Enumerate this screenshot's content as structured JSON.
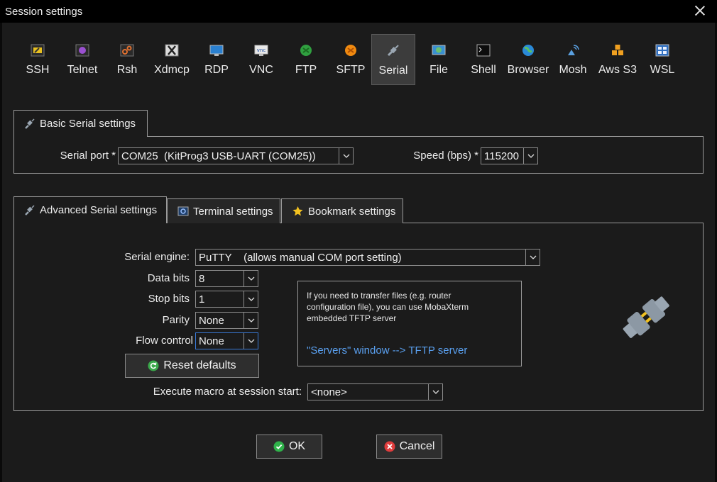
{
  "window": {
    "title": "Session settings"
  },
  "toolbar": {
    "items": [
      {
        "label": "SSH",
        "icon": "ssh-icon"
      },
      {
        "label": "Telnet",
        "icon": "telnet-icon"
      },
      {
        "label": "Rsh",
        "icon": "rsh-icon"
      },
      {
        "label": "Xdmcp",
        "icon": "xdmcp-icon"
      },
      {
        "label": "RDP",
        "icon": "rdp-icon"
      },
      {
        "label": "VNC",
        "icon": "vnc-icon"
      },
      {
        "label": "FTP",
        "icon": "ftp-icon"
      },
      {
        "label": "SFTP",
        "icon": "sftp-icon"
      },
      {
        "label": "Serial",
        "icon": "serial-plug-icon",
        "selected": true
      },
      {
        "label": "File",
        "icon": "file-icon"
      },
      {
        "label": "Shell",
        "icon": "shell-icon"
      },
      {
        "label": "Browser",
        "icon": "browser-icon"
      },
      {
        "label": "Mosh",
        "icon": "mosh-icon"
      },
      {
        "label": "Aws S3",
        "icon": "aws-s3-icon"
      },
      {
        "label": "WSL",
        "icon": "wsl-icon"
      }
    ]
  },
  "basic": {
    "tab_label": "Basic Serial settings",
    "serial_port_label": "Serial port *",
    "serial_port_value": "COM25  (KitProg3 USB-UART (COM25))",
    "speed_label": "Speed (bps) *",
    "speed_value": "115200"
  },
  "advanced": {
    "tabs": [
      {
        "label": "Advanced Serial settings",
        "icon": "serial-plug-icon",
        "active": true
      },
      {
        "label": "Terminal settings",
        "icon": "terminal-settings-icon"
      },
      {
        "label": "Bookmark settings",
        "icon": "star-icon"
      }
    ],
    "engine_label": "Serial engine:",
    "engine_value": "PuTTY    (allows manual COM port setting)",
    "data_bits_label": "Data bits",
    "data_bits_value": "8",
    "stop_bits_label": "Stop bits",
    "stop_bits_value": "1",
    "parity_label": "Parity",
    "parity_value": "None",
    "flow_control_label": "Flow control",
    "flow_control_value": "None",
    "reset_label": "Reset defaults",
    "macro_label": "Execute macro at session start:",
    "macro_value": "<none>",
    "info_text": "If you need to transfer files (e.g. router configuration file), you can use MobaXterm embedded TFTP server",
    "info_link": "\"Servers\" window  -->  TFTP server"
  },
  "footer": {
    "ok_label": "OK",
    "cancel_label": "Cancel"
  },
  "colors": {
    "background": "#1b1b1b",
    "titlebar": "#000000",
    "link": "#5aa0f0",
    "ok_green": "#2fb24a",
    "cancel_red": "#e03c3c"
  }
}
